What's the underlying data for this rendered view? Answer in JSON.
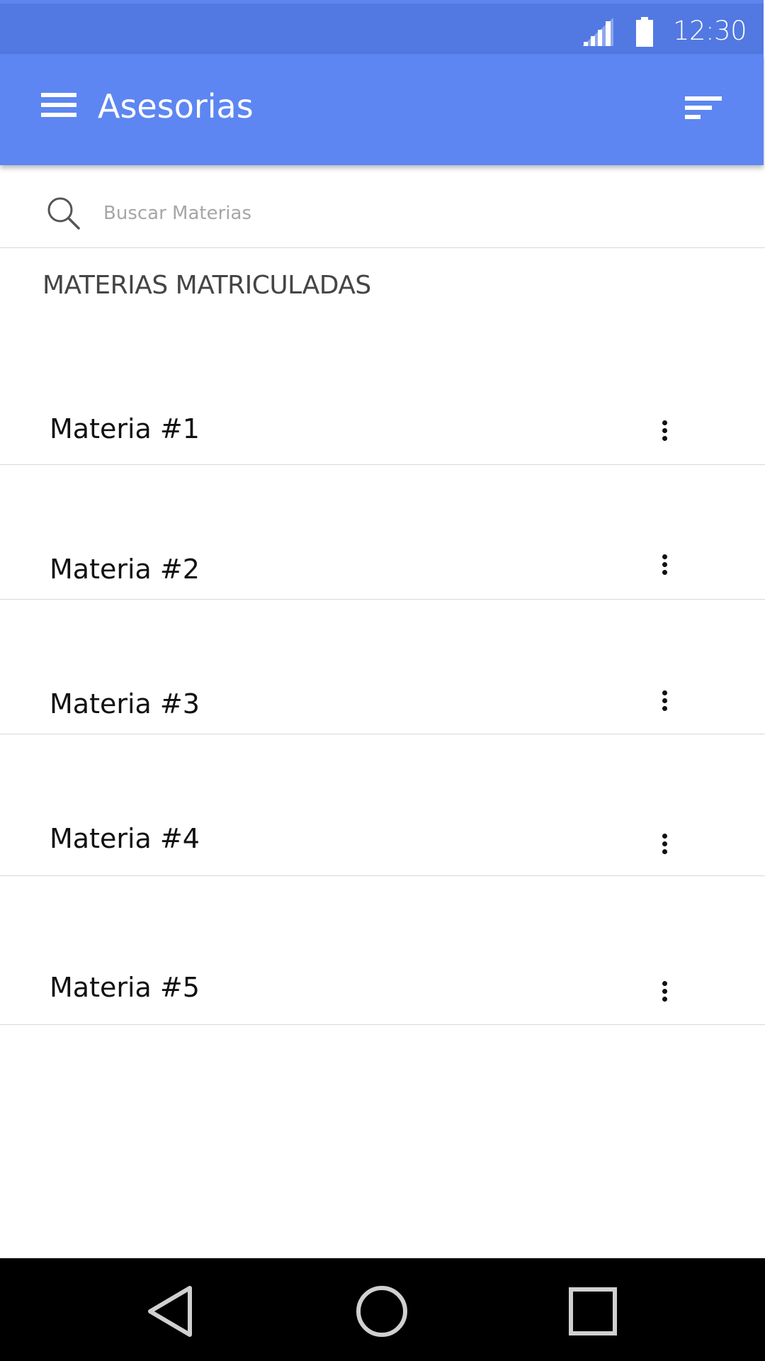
{
  "status_bar": {
    "time": "12:30",
    "icons": [
      "signal-icon",
      "battery-icon"
    ],
    "background_color": "#5278e2"
  },
  "app_bar": {
    "title": "Asesorias",
    "menu_icon": "menu-icon",
    "sort_icon": "sort-icon",
    "background_color": "#5d86f2"
  },
  "search": {
    "placeholder": "Buscar Materias",
    "value": "",
    "icon": "search-icon"
  },
  "section": {
    "title": "MATERIAS MATRICULADAS"
  },
  "list": {
    "items": [
      {
        "label": "Materia #1",
        "action_icon": "more-vert-icon"
      },
      {
        "label": "Materia #2",
        "action_icon": "more-vert-icon"
      },
      {
        "label": "Materia #3",
        "action_icon": "more-vert-icon"
      },
      {
        "label": "Materia #4",
        "action_icon": "more-vert-icon"
      },
      {
        "label": "Materia #5",
        "action_icon": "more-vert-icon"
      }
    ]
  },
  "nav_bar": {
    "buttons": [
      "back-icon",
      "home-icon",
      "recents-icon"
    ]
  }
}
